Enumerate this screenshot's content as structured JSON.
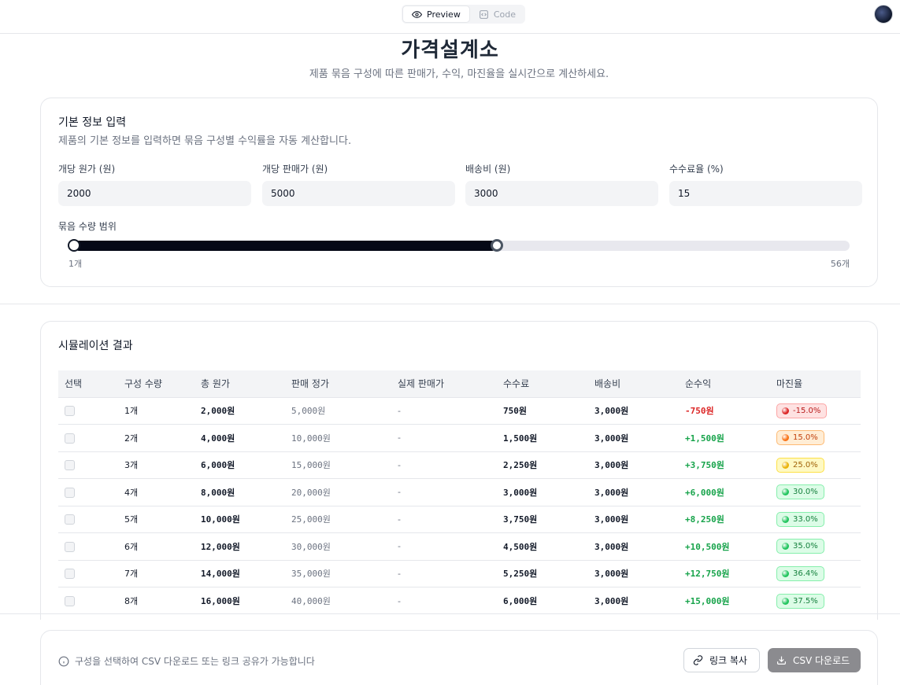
{
  "topbar": {
    "preview_label": "Preview",
    "code_label": "Code",
    "preview_icon": "eye-icon",
    "code_icon": "code-icon"
  },
  "page": {
    "title": "가격설계소",
    "subtitle": "제품 묶음 구성에 따른 판매가, 수익, 마진율을 실시간으로 계산하세요."
  },
  "basic_info": {
    "title": "기본 정보 입력",
    "description": "제품의 기본 정보를 입력하면 묶음 구성별 수익률을 자동 계산합니다.",
    "fields": [
      {
        "label": "개당 원가 (원)",
        "value": "2000"
      },
      {
        "label": "개당 판매가 (원)",
        "value": "5000"
      },
      {
        "label": "배송비 (원)",
        "value": "3000"
      },
      {
        "label": "수수료율 (%)",
        "value": "15"
      }
    ],
    "range": {
      "label": "묶음 수량 범위",
      "min_label": "1개",
      "max_label": "56개",
      "min": 1,
      "max": 56,
      "low": 1,
      "high": 31
    }
  },
  "results": {
    "title": "시뮬레이션 결과",
    "columns": [
      "선택",
      "구성 수량",
      "총 원가",
      "판매 정가",
      "실제 판매가",
      "수수료",
      "배송비",
      "순수익",
      "마진율"
    ],
    "rows": [
      {
        "qty": "1개",
        "cost": "2,000원",
        "list": "5,000원",
        "actual": "-",
        "fee": "750원",
        "ship": "3,000원",
        "profit": "-750원",
        "margin": "-15.0%",
        "tone": "red"
      },
      {
        "qty": "2개",
        "cost": "4,000원",
        "list": "10,000원",
        "actual": "-",
        "fee": "1,500원",
        "ship": "3,000원",
        "profit": "+1,500원",
        "margin": "15.0%",
        "tone": "orange"
      },
      {
        "qty": "3개",
        "cost": "6,000원",
        "list": "15,000원",
        "actual": "-",
        "fee": "2,250원",
        "ship": "3,000원",
        "profit": "+3,750원",
        "margin": "25.0%",
        "tone": "yellow"
      },
      {
        "qty": "4개",
        "cost": "8,000원",
        "list": "20,000원",
        "actual": "-",
        "fee": "3,000원",
        "ship": "3,000원",
        "profit": "+6,000원",
        "margin": "30.0%",
        "tone": "green"
      },
      {
        "qty": "5개",
        "cost": "10,000원",
        "list": "25,000원",
        "actual": "-",
        "fee": "3,750원",
        "ship": "3,000원",
        "profit": "+8,250원",
        "margin": "33.0%",
        "tone": "green"
      },
      {
        "qty": "6개",
        "cost": "12,000원",
        "list": "30,000원",
        "actual": "-",
        "fee": "4,500원",
        "ship": "3,000원",
        "profit": "+10,500원",
        "margin": "35.0%",
        "tone": "green"
      },
      {
        "qty": "7개",
        "cost": "14,000원",
        "list": "35,000원",
        "actual": "-",
        "fee": "5,250원",
        "ship": "3,000원",
        "profit": "+12,750원",
        "margin": "36.4%",
        "tone": "green"
      },
      {
        "qty": "8개",
        "cost": "16,000원",
        "list": "40,000원",
        "actual": "-",
        "fee": "6,000원",
        "ship": "3,000원",
        "profit": "+15,000원",
        "margin": "37.5%",
        "tone": "green"
      }
    ]
  },
  "badge_colors": {
    "red": {
      "bg": "#fee2e2",
      "border": "#fca5a5",
      "text": "#b91c1c",
      "dot": "#dc2626"
    },
    "orange": {
      "bg": "#ffedd5",
      "border": "#fdba74",
      "text": "#c2410c",
      "dot": "#f97316"
    },
    "yellow": {
      "bg": "#fef9c3",
      "border": "#fde047",
      "text": "#a16207",
      "dot": "#eab308"
    },
    "green": {
      "bg": "#dcfce7",
      "border": "#86efac",
      "text": "#15803d",
      "dot": "#22c55e"
    }
  },
  "footer": {
    "info_icon": "info-icon",
    "note": "구성을 선택하여 CSV 다운로드 또는 링크 공유가 가능합니다",
    "copy_link_label": "링크 복사",
    "csv_label": "CSV 다운로드"
  }
}
